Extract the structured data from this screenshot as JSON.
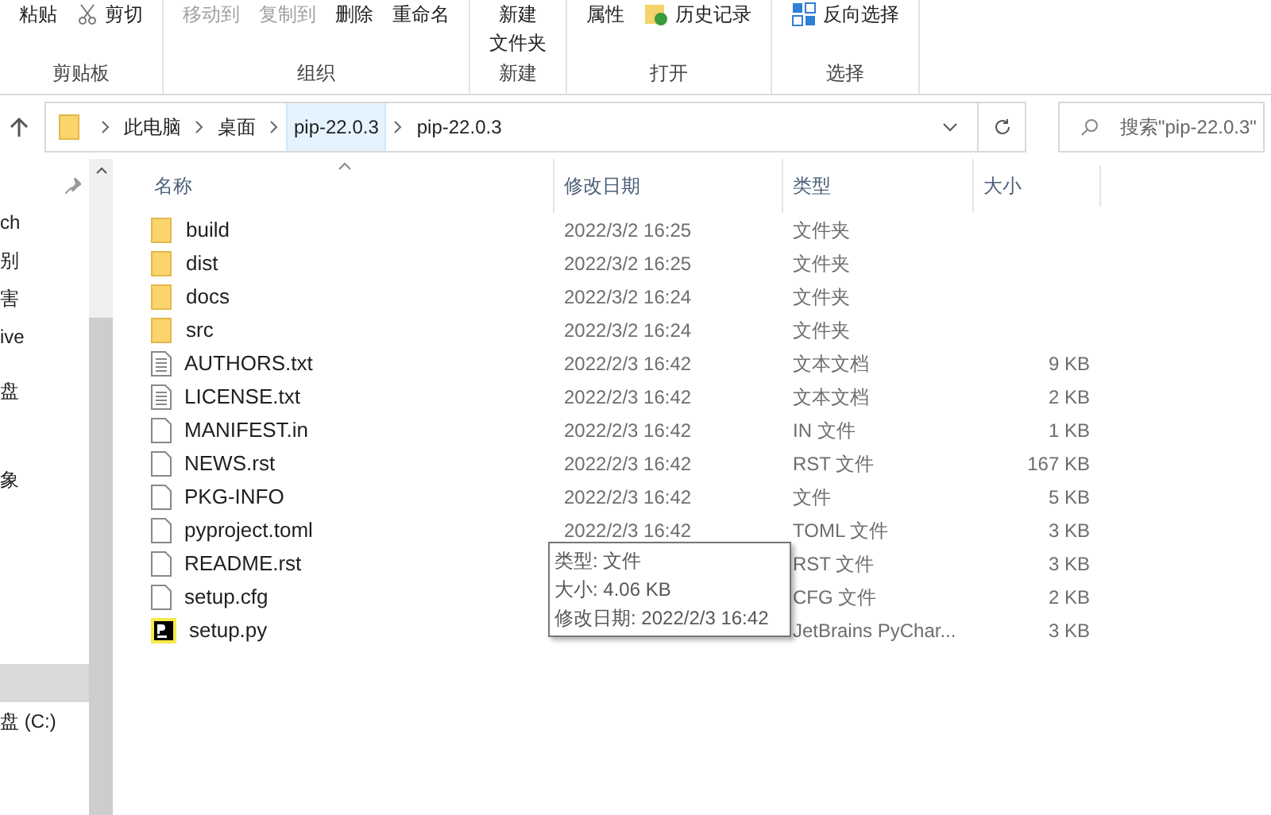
{
  "ribbon": {
    "groups": [
      {
        "label": "剪贴板",
        "items": [
          {
            "text": "粘贴",
            "disabled": false
          },
          {
            "text": "剪切",
            "disabled": false
          }
        ]
      },
      {
        "label": "组织",
        "items": [
          {
            "text": "移动到",
            "disabled": true
          },
          {
            "text": "复制到",
            "disabled": true
          },
          {
            "text": "删除",
            "disabled": false
          },
          {
            "text": "重命名",
            "disabled": false
          }
        ]
      },
      {
        "label": "新建",
        "items": [
          {
            "text": "新建文件夹",
            "disabled": false
          }
        ]
      },
      {
        "label": "打开",
        "items": [
          {
            "text": "属性",
            "disabled": false
          },
          {
            "text": "历史记录",
            "disabled": false
          }
        ]
      },
      {
        "label": "选择",
        "items": [
          {
            "text": "反向选择",
            "disabled": false
          }
        ]
      }
    ]
  },
  "address_bar": {
    "crumbs": [
      {
        "text": "此电脑",
        "selected": false
      },
      {
        "text": "桌面",
        "selected": false
      },
      {
        "text": "pip-22.0.3",
        "selected": true
      },
      {
        "text": "pip-22.0.3",
        "selected": false
      }
    ]
  },
  "search": {
    "placeholder": "搜索\"pip-22.0.3\""
  },
  "sidebar": {
    "items": [
      {
        "text": "ch",
        "selected": false
      },
      {
        "text": "别",
        "selected": false
      },
      {
        "text": "害",
        "selected": false
      },
      {
        "text": "ive",
        "selected": false
      },
      {
        "text": "盘",
        "selected": false
      },
      {
        "text": "象",
        "selected": false
      },
      {
        "selected": true
      },
      {
        "text": "盘 (C:)",
        "selected": false
      }
    ]
  },
  "table": {
    "columns": [
      "名称",
      "修改日期",
      "类型",
      "大小"
    ],
    "rows": [
      {
        "kind": "folder",
        "name": "build",
        "date": "2022/3/2 16:25",
        "type": "文件夹"
      },
      {
        "kind": "folder",
        "name": "dist",
        "date": "2022/3/2 16:25",
        "type": "文件夹"
      },
      {
        "kind": "folder",
        "name": "docs",
        "date": "2022/3/2 16:24",
        "type": "文件夹"
      },
      {
        "kind": "folder",
        "name": "src",
        "date": "2022/3/2 16:24",
        "type": "文件夹"
      },
      {
        "kind": "text",
        "name": "AUTHORS.txt",
        "date": "2022/2/3 16:42",
        "type": "文本文档",
        "size": "9 KB"
      },
      {
        "kind": "text",
        "name": "LICENSE.txt",
        "date": "2022/2/3 16:42",
        "type": "文本文档",
        "size": "2 KB"
      },
      {
        "kind": "file",
        "name": "MANIFEST.in",
        "date": "2022/2/3 16:42",
        "type": "IN 文件",
        "size": "1 KB"
      },
      {
        "kind": "file",
        "name": "NEWS.rst",
        "date": "2022/2/3 16:42",
        "type": "RST 文件",
        "size": "167 KB"
      },
      {
        "kind": "file",
        "name": "PKG-INFO",
        "date": "2022/2/3 16:42",
        "type": "文件",
        "size": "5 KB"
      },
      {
        "kind": "file",
        "name": "pyproject.toml",
        "date": "2022/2/3 16:42",
        "type": "TOML 文件",
        "size": "3 KB"
      },
      {
        "kind": "file",
        "name": "README.rst",
        "type": "RST 文件",
        "size": "3 KB"
      },
      {
        "kind": "file",
        "name": "setup.cfg",
        "type": "CFG 文件",
        "size": "2 KB"
      },
      {
        "kind": "pycharm",
        "name": "setup.py",
        "type": "JetBrains PyChar...",
        "size": "3 KB"
      }
    ]
  },
  "tooltip": {
    "lines": [
      "类型: 文件",
      "大小: 4.06 KB",
      "修改日期: 2022/2/3 16:42"
    ]
  }
}
